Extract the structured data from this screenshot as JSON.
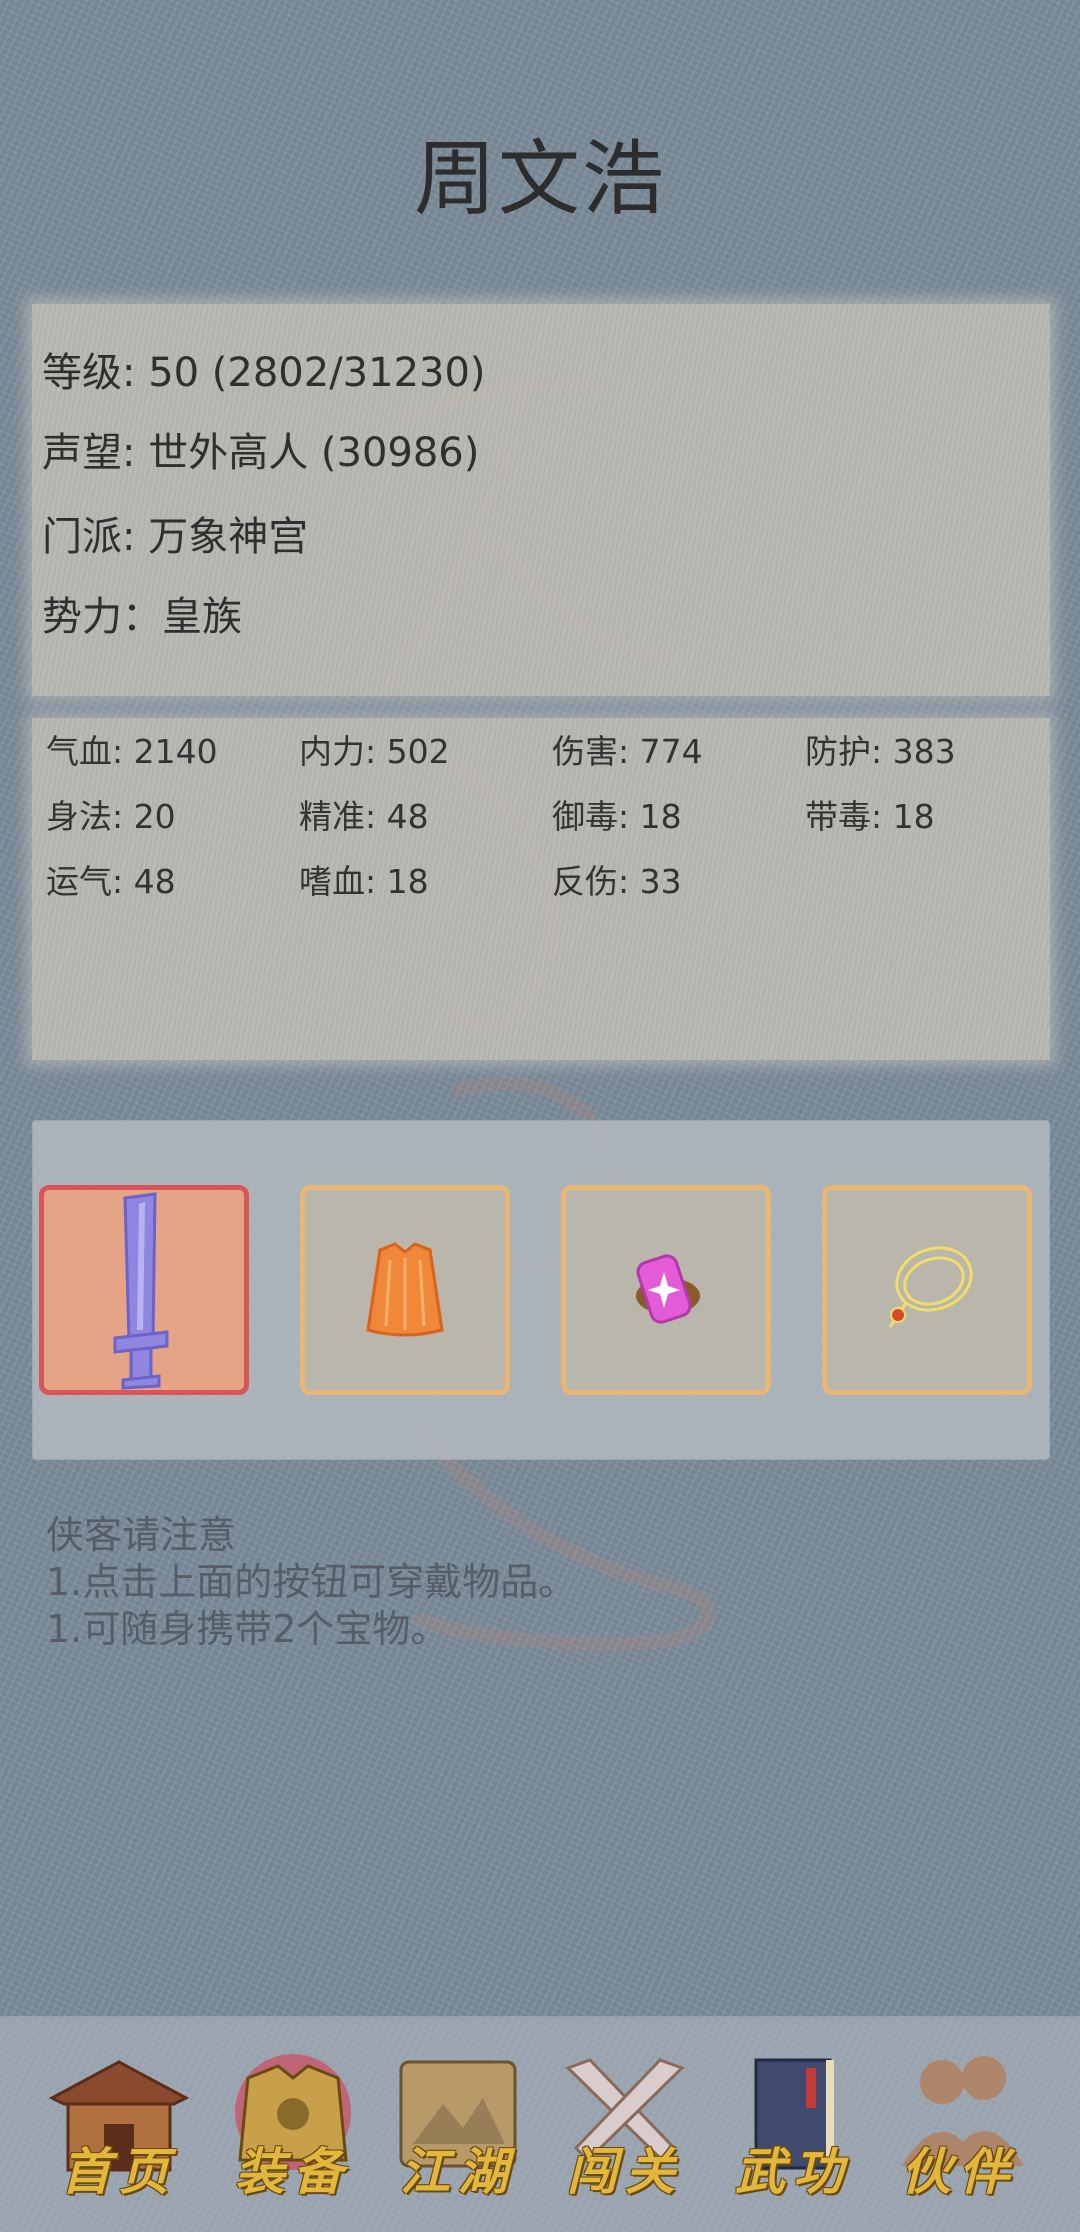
{
  "character": {
    "name": "周文浩",
    "level": "等级: 50 (2802/31230)",
    "reputation": "声望: 世外高人 (30986)",
    "sect": "门派: 万象神宫",
    "faction": "势力：皇族"
  },
  "stats": [
    "气血: 2140",
    "内力: 502",
    "伤害: 774",
    "防护: 383",
    "身法: 20",
    "精准: 48",
    "御毒: 18",
    "带毒: 18",
    "运气: 48",
    "嗜血: 18",
    "反伤: 33"
  ],
  "equipment": {
    "slots": [
      {
        "icon": "sword-icon",
        "active": true
      },
      {
        "icon": "armor-icon",
        "active": false
      },
      {
        "icon": "ring-icon",
        "active": false
      },
      {
        "icon": "necklace-icon",
        "active": false
      }
    ]
  },
  "notice": {
    "title": "侠客请注意",
    "line1": "1.点击上面的按钮可穿戴物品。",
    "line2": "1.可随身携带2个宝物。"
  },
  "nav": {
    "home": "首页",
    "equip": "装备",
    "jianghu": "江湖",
    "challenge": "闯关",
    "martial": "武功",
    "partner": "伙伴"
  },
  "colors": {
    "background": "#7d8c9b",
    "slot_border": "#e9b774",
    "slot_active_border": "#d9555a",
    "nav_label": "#e3b73c"
  }
}
